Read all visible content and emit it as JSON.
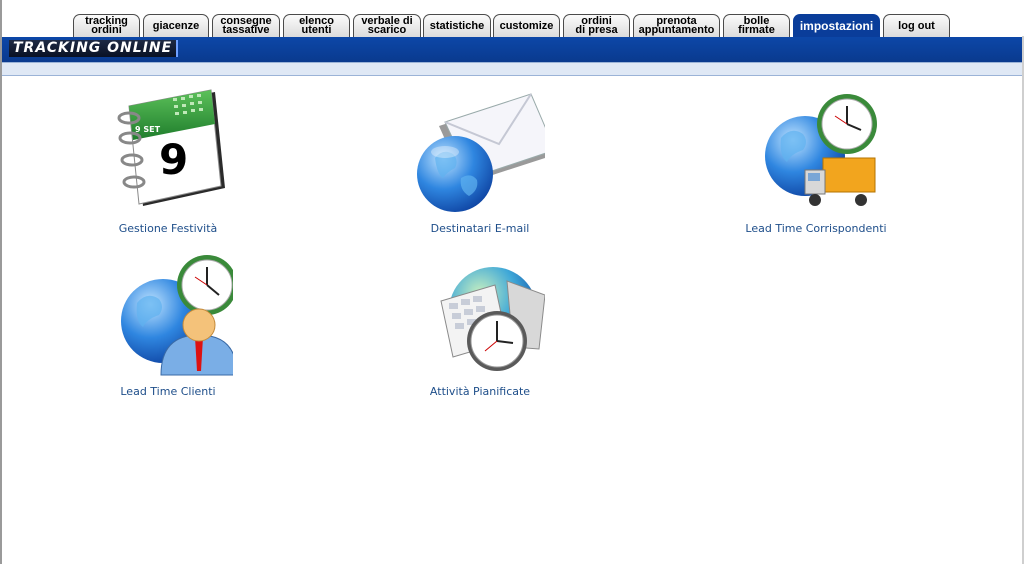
{
  "tabs": [
    {
      "label": "tracking\nordini"
    },
    {
      "label": "giacenze"
    },
    {
      "label": "consegne\ntassative"
    },
    {
      "label": "elenco\nutenti"
    },
    {
      "label": "verbale di\nscarico"
    },
    {
      "label": "statistiche"
    },
    {
      "label": "customize"
    },
    {
      "label": "ordini\ndi presa"
    },
    {
      "label": "prenota\nappuntamento"
    },
    {
      "label": "bolle\nfirmate"
    },
    {
      "label": "impostazioni",
      "active": true
    },
    {
      "label": "log out"
    }
  ],
  "header": {
    "title": "TRACKING ONLINE"
  },
  "calendar": {
    "day": "9",
    "month": "9 SET"
  },
  "tiles": [
    {
      "label": "Gestione Festività",
      "icon": "calendar-icon"
    },
    {
      "label": "Destinatari E-mail",
      "icon": "email-globe-icon"
    },
    {
      "label": "Lead Time Corrispondenti",
      "icon": "globe-clock-truck-icon"
    },
    {
      "label": "Lead Time Clienti",
      "icon": "globe-clock-user-icon"
    },
    {
      "label": "Attività Pianificate",
      "icon": "calendar-clock-icon"
    }
  ]
}
